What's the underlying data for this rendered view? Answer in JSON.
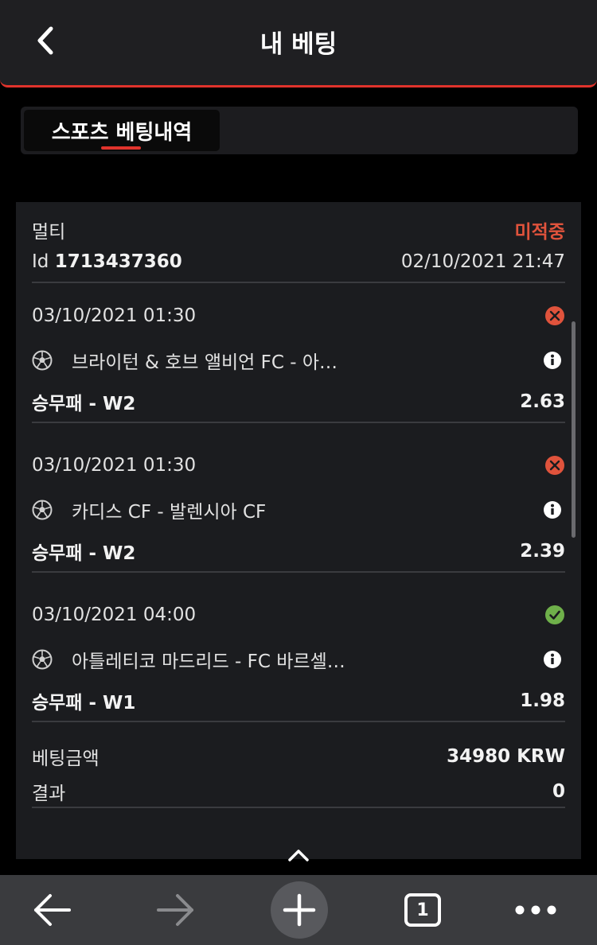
{
  "header": {
    "title": "내 베팅"
  },
  "tabs": [
    {
      "label": "스포츠 베팅내역",
      "active": true
    }
  ],
  "bet": {
    "type": "멀티",
    "status": "미적중",
    "id_label": "Id",
    "id_value": "1713437360",
    "placed_at": "02/10/2021 21:47",
    "selections": [
      {
        "datetime": "03/10/2021 01:30",
        "result_icon": "x-circle-icon",
        "match": "브라이턴 & 호브 앨비언 FC - 아…",
        "market": "승무패 - W2",
        "odds": "2.63"
      },
      {
        "datetime": "03/10/2021 01:30",
        "result_icon": "x-circle-icon",
        "match": "카디스 CF - 발렌시아 CF",
        "market": "승무패 - W2",
        "odds": "2.39"
      },
      {
        "datetime": "03/10/2021 04:00",
        "result_icon": "check-circle-icon",
        "match": "아틀레티코 마드리드 - FC 바르셀…",
        "market": "승무패 - W1",
        "odds": "1.98"
      }
    ],
    "stake_label": "베팅금액",
    "stake_value": "34980 KRW",
    "result_label": "결과",
    "result_value": "0"
  },
  "browser_bar": {
    "tab_count": "1"
  },
  "colors": {
    "accent": "#e0332c",
    "lost": "#e0533c",
    "won": "#6fb04a",
    "card_bg": "#1b1c1f"
  }
}
